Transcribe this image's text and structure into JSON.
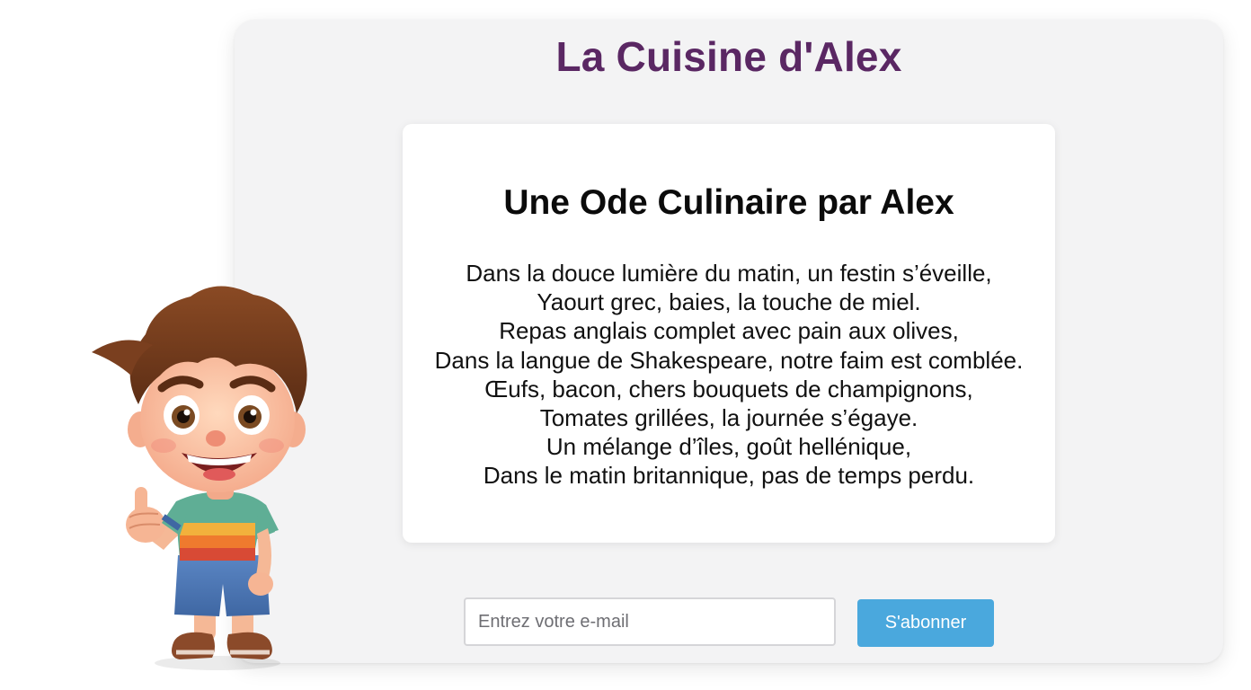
{
  "header": {
    "site_title": "La Cuisine d'Alex"
  },
  "poem": {
    "title": "Une Ode Culinaire par Alex",
    "lines": [
      "Dans la douce lumière du matin, un festin s’éveille,",
      "Yaourt grec, baies, la touche de miel.",
      "Repas anglais complet avec pain aux olives,",
      "Dans la langue de Shakespeare, notre faim est comblée.",
      "Œufs, bacon, chers bouquets de champignons,",
      "Tomates grillées, la journée s’égaye.",
      "Un mélange d’îles, goût hellénique,",
      "Dans le matin britannique, pas de temps perdu."
    ]
  },
  "newsletter": {
    "email_placeholder": "Entrez votre e-mail",
    "email_value": "",
    "subscribe_label": "S'abonner"
  },
  "mascot": {
    "icon": "cartoon-boy-thumbs-up-icon"
  },
  "colors": {
    "title": "#5a2763",
    "button": "#4aa8dd",
    "panel": "#f3f3f4",
    "card": "#ffffff"
  }
}
